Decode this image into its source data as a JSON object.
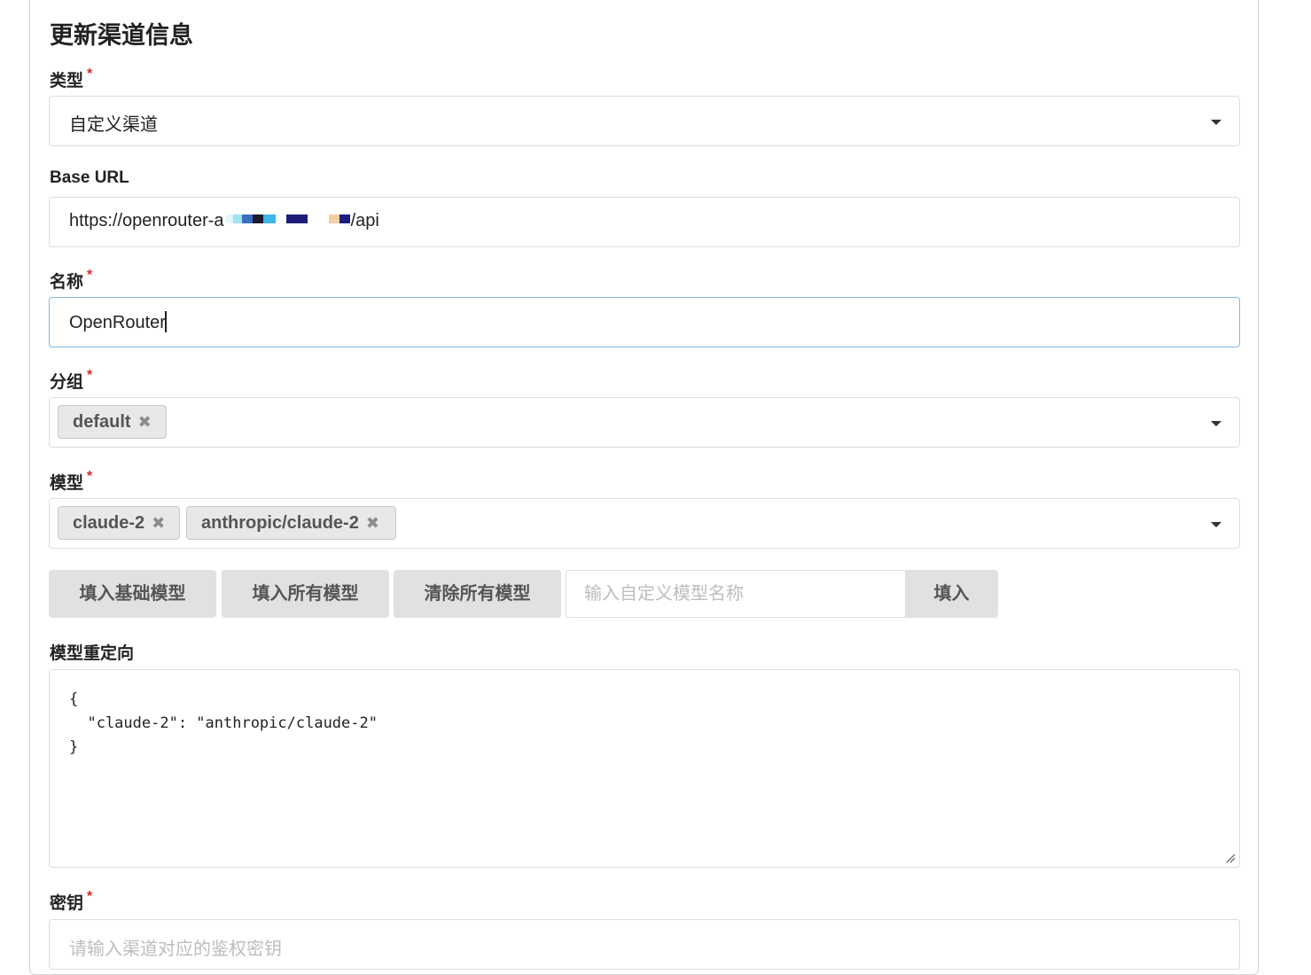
{
  "form": {
    "title": "更新渠道信息",
    "required_mark": "*",
    "type": {
      "label": "类型",
      "value": "自定义渠道"
    },
    "base_url": {
      "label": "Base URL",
      "prefix": "https://openrouter-a",
      "suffix": "/api"
    },
    "name": {
      "label": "名称",
      "value": "OpenRouter"
    },
    "group": {
      "label": "分组",
      "chips": [
        "default"
      ]
    },
    "models": {
      "label": "模型",
      "chips": [
        "claude-2",
        "anthropic/claude-2"
      ]
    },
    "buttons": {
      "fill_basic": "填入基础模型",
      "fill_all": "填入所有模型",
      "clear_all": "清除所有模型",
      "custom_placeholder": "输入自定义模型名称",
      "fill": "填入"
    },
    "model_mapping": {
      "label": "模型重定向",
      "value": "{\n  \"claude-2\": \"anthropic/claude-2\"\n}"
    },
    "key": {
      "label": "密钥",
      "placeholder": "请输入渠道对应的鉴权密钥"
    },
    "icons": {
      "remove": "✖",
      "dropdown": "caret-down-icon"
    },
    "colors": {
      "required": "#db2828",
      "focus_border": "#85b7d9",
      "button_bg": "#e0e1e2"
    }
  }
}
